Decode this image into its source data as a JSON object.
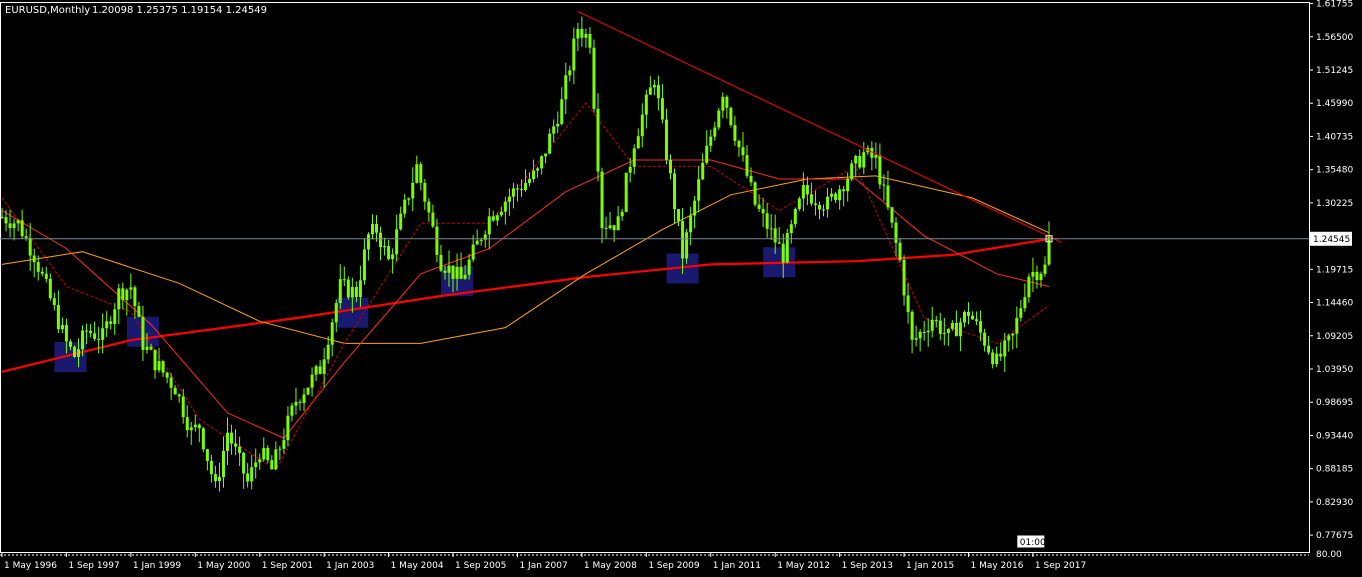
{
  "header": {
    "symbol": "EURUSD,Monthly",
    "ohlc": "1.20098 1.25375 1.19154 1.24549"
  },
  "current_price_label": "1.24545",
  "time_label": "01:00",
  "bottom_right_label": "80.00",
  "colors": {
    "background": "#000000",
    "axis": "#ffffff",
    "candle": "#7cfc00",
    "ma_thick": "#ff0000",
    "ma_orange": "#ffa500",
    "ma_thin": "#ff2a2a",
    "ma_dashed": "#cc0000",
    "trendline": "#ff0000",
    "zone": "#191970",
    "price_line": "#778899"
  },
  "chart_data": {
    "type": "line",
    "title": "EURUSD,Monthly",
    "y_ticks": [
      "1.61755",
      "1.56500",
      "1.51245",
      "1.45990",
      "1.40735",
      "1.35480",
      "1.30225",
      "1.24545",
      "1.19715",
      "1.14460",
      "1.09205",
      "1.03950",
      "0.98695",
      "0.93440",
      "0.88185",
      "0.82930",
      "0.77675"
    ],
    "x_ticks": [
      "1 May 1996",
      "1 Sep 1997",
      "1 Jan 1999",
      "1 May 2000",
      "1 Sep 2001",
      "1 Jan 2003",
      "1 May 2004",
      "1 Sep 2005",
      "1 Jan 2007",
      "1 May 2008",
      "1 Sep 2009",
      "1 Jan 2011",
      "1 May 2012",
      "1 Sep 2013",
      "1 Jan 2015",
      "1 May 2016",
      "1 Sep 2017"
    ],
    "ylim": [
      0.75,
      1.62
    ],
    "x_start": "1996-05",
    "x_end": "2017-12",
    "price_series": [
      {
        "x": "1996-05",
        "y": 1.28
      },
      {
        "x": "1996-09",
        "y": 1.27
      },
      {
        "x": "1997-01",
        "y": 1.22
      },
      {
        "x": "1997-05",
        "y": 1.15
      },
      {
        "x": "1997-09",
        "y": 1.08
      },
      {
        "x": "1997-11",
        "y": 1.06
      },
      {
        "x": "1998-02",
        "y": 1.1
      },
      {
        "x": "1998-06",
        "y": 1.09
      },
      {
        "x": "1998-10",
        "y": 1.16
      },
      {
        "x": "1999-01",
        "y": 1.17
      },
      {
        "x": "1999-04",
        "y": 1.08
      },
      {
        "x": "1999-07",
        "y": 1.05
      },
      {
        "x": "1999-12",
        "y": 1.01
      },
      {
        "x": "2000-04",
        "y": 0.94
      },
      {
        "x": "2000-06",
        "y": 0.95
      },
      {
        "x": "2000-10",
        "y": 0.85
      },
      {
        "x": "2001-01",
        "y": 0.94
      },
      {
        "x": "2001-06",
        "y": 0.86
      },
      {
        "x": "2001-09",
        "y": 0.91
      },
      {
        "x": "2001-12",
        "y": 0.88
      },
      {
        "x": "2002-06",
        "y": 0.99
      },
      {
        "x": "2002-12",
        "y": 1.04
      },
      {
        "x": "2003-05",
        "y": 1.17
      },
      {
        "x": "2003-09",
        "y": 1.16
      },
      {
        "x": "2003-12",
        "y": 1.25
      },
      {
        "x": "2004-02",
        "y": 1.26
      },
      {
        "x": "2004-05",
        "y": 1.21
      },
      {
        "x": "2004-12",
        "y": 1.36
      },
      {
        "x": "2005-06",
        "y": 1.21
      },
      {
        "x": "2005-11",
        "y": 1.18
      },
      {
        "x": "2006-06",
        "y": 1.28
      },
      {
        "x": "2006-12",
        "y": 1.32
      },
      {
        "x": "2007-06",
        "y": 1.35
      },
      {
        "x": "2007-12",
        "y": 1.46
      },
      {
        "x": "2008-04",
        "y": 1.58
      },
      {
        "x": "2008-07",
        "y": 1.56
      },
      {
        "x": "2008-10",
        "y": 1.27
      },
      {
        "x": "2009-02",
        "y": 1.27
      },
      {
        "x": "2009-06",
        "y": 1.4
      },
      {
        "x": "2009-11",
        "y": 1.5
      },
      {
        "x": "2010-06",
        "y": 1.22
      },
      {
        "x": "2010-11",
        "y": 1.36
      },
      {
        "x": "2011-04",
        "y": 1.48
      },
      {
        "x": "2011-12",
        "y": 1.3
      },
      {
        "x": "2012-07",
        "y": 1.22
      },
      {
        "x": "2012-12",
        "y": 1.32
      },
      {
        "x": "2013-06",
        "y": 1.3
      },
      {
        "x": "2014-03",
        "y": 1.38
      },
      {
        "x": "2014-06",
        "y": 1.37
      },
      {
        "x": "2014-12",
        "y": 1.21
      },
      {
        "x": "2015-03",
        "y": 1.08
      },
      {
        "x": "2015-08",
        "y": 1.12
      },
      {
        "x": "2015-12",
        "y": 1.09
      },
      {
        "x": "2016-05",
        "y": 1.13
      },
      {
        "x": "2016-12",
        "y": 1.05
      },
      {
        "x": "2017-04",
        "y": 1.09
      },
      {
        "x": "2017-08",
        "y": 1.19
      },
      {
        "x": "2017-12",
        "y": 1.2
      },
      {
        "x": "2018-01",
        "y": 1.245
      }
    ],
    "moving_averages": [
      {
        "style": "thick-red",
        "points": [
          {
            "x": "1996-05",
            "y": 1.035
          },
          {
            "x": "1999-01",
            "y": 1.085
          },
          {
            "x": "2002-06",
            "y": 1.12
          },
          {
            "x": "2005-06",
            "y": 1.155
          },
          {
            "x": "2008-06",
            "y": 1.185
          },
          {
            "x": "2011-01",
            "y": 1.205
          },
          {
            "x": "2014-01",
            "y": 1.21
          },
          {
            "x": "2016-01",
            "y": 1.22
          },
          {
            "x": "2018-01",
            "y": 1.245
          }
        ]
      },
      {
        "style": "orange",
        "points": [
          {
            "x": "1996-05",
            "y": 1.205
          },
          {
            "x": "1998-01",
            "y": 1.225
          },
          {
            "x": "2000-01",
            "y": 1.175
          },
          {
            "x": "2001-09",
            "y": 1.115
          },
          {
            "x": "2003-06",
            "y": 1.08
          },
          {
            "x": "2005-01",
            "y": 1.08
          },
          {
            "x": "2006-10",
            "y": 1.105
          },
          {
            "x": "2008-06",
            "y": 1.19
          },
          {
            "x": "2010-01",
            "y": 1.26
          },
          {
            "x": "2011-06",
            "y": 1.315
          },
          {
            "x": "2013-01",
            "y": 1.34
          },
          {
            "x": "2014-06",
            "y": 1.345
          },
          {
            "x": "2016-06",
            "y": 1.31
          },
          {
            "x": "2018-01",
            "y": 1.255
          }
        ]
      },
      {
        "style": "thin-red",
        "points": [
          {
            "x": "1996-05",
            "y": 1.29
          },
          {
            "x": "1997-09",
            "y": 1.23
          },
          {
            "x": "1999-06",
            "y": 1.11
          },
          {
            "x": "2001-01",
            "y": 0.97
          },
          {
            "x": "2002-03",
            "y": 0.93
          },
          {
            "x": "2003-06",
            "y": 1.05
          },
          {
            "x": "2005-01",
            "y": 1.19
          },
          {
            "x": "2006-06",
            "y": 1.23
          },
          {
            "x": "2008-01",
            "y": 1.32
          },
          {
            "x": "2009-06",
            "y": 1.37
          },
          {
            "x": "2011-01",
            "y": 1.37
          },
          {
            "x": "2012-06",
            "y": 1.34
          },
          {
            "x": "2014-01",
            "y": 1.34
          },
          {
            "x": "2015-06",
            "y": 1.25
          },
          {
            "x": "2016-12",
            "y": 1.19
          },
          {
            "x": "2018-01",
            "y": 1.17
          }
        ]
      },
      {
        "style": "dashed-red",
        "points": [
          {
            "x": "1996-05",
            "y": 1.31
          },
          {
            "x": "1997-09",
            "y": 1.17
          },
          {
            "x": "1999-01",
            "y": 1.13
          },
          {
            "x": "2000-06",
            "y": 0.96
          },
          {
            "x": "2002-01",
            "y": 0.88
          },
          {
            "x": "2003-06",
            "y": 1.08
          },
          {
            "x": "2005-01",
            "y": 1.27
          },
          {
            "x": "2006-06",
            "y": 1.27
          },
          {
            "x": "2008-06",
            "y": 1.46
          },
          {
            "x": "2009-06",
            "y": 1.36
          },
          {
            "x": "2011-01",
            "y": 1.36
          },
          {
            "x": "2012-06",
            "y": 1.29
          },
          {
            "x": "2014-01",
            "y": 1.36
          },
          {
            "x": "2015-06",
            "y": 1.12
          },
          {
            "x": "2016-12",
            "y": 1.08
          },
          {
            "x": "2018-01",
            "y": 1.14
          }
        ]
      }
    ],
    "trendline": [
      {
        "x": "2008-04",
        "y": 1.605
      },
      {
        "x": "2018-04",
        "y": 1.24
      }
    ],
    "zones": [
      {
        "x": "1997-10",
        "y": 1.06
      },
      {
        "x": "1999-04",
        "y": 1.1
      },
      {
        "x": "2003-08",
        "y": 1.13
      },
      {
        "x": "2005-10",
        "y": 1.18
      },
      {
        "x": "2010-06",
        "y": 1.2
      },
      {
        "x": "2012-06",
        "y": 1.21
      }
    ],
    "current_price": 1.24545
  }
}
